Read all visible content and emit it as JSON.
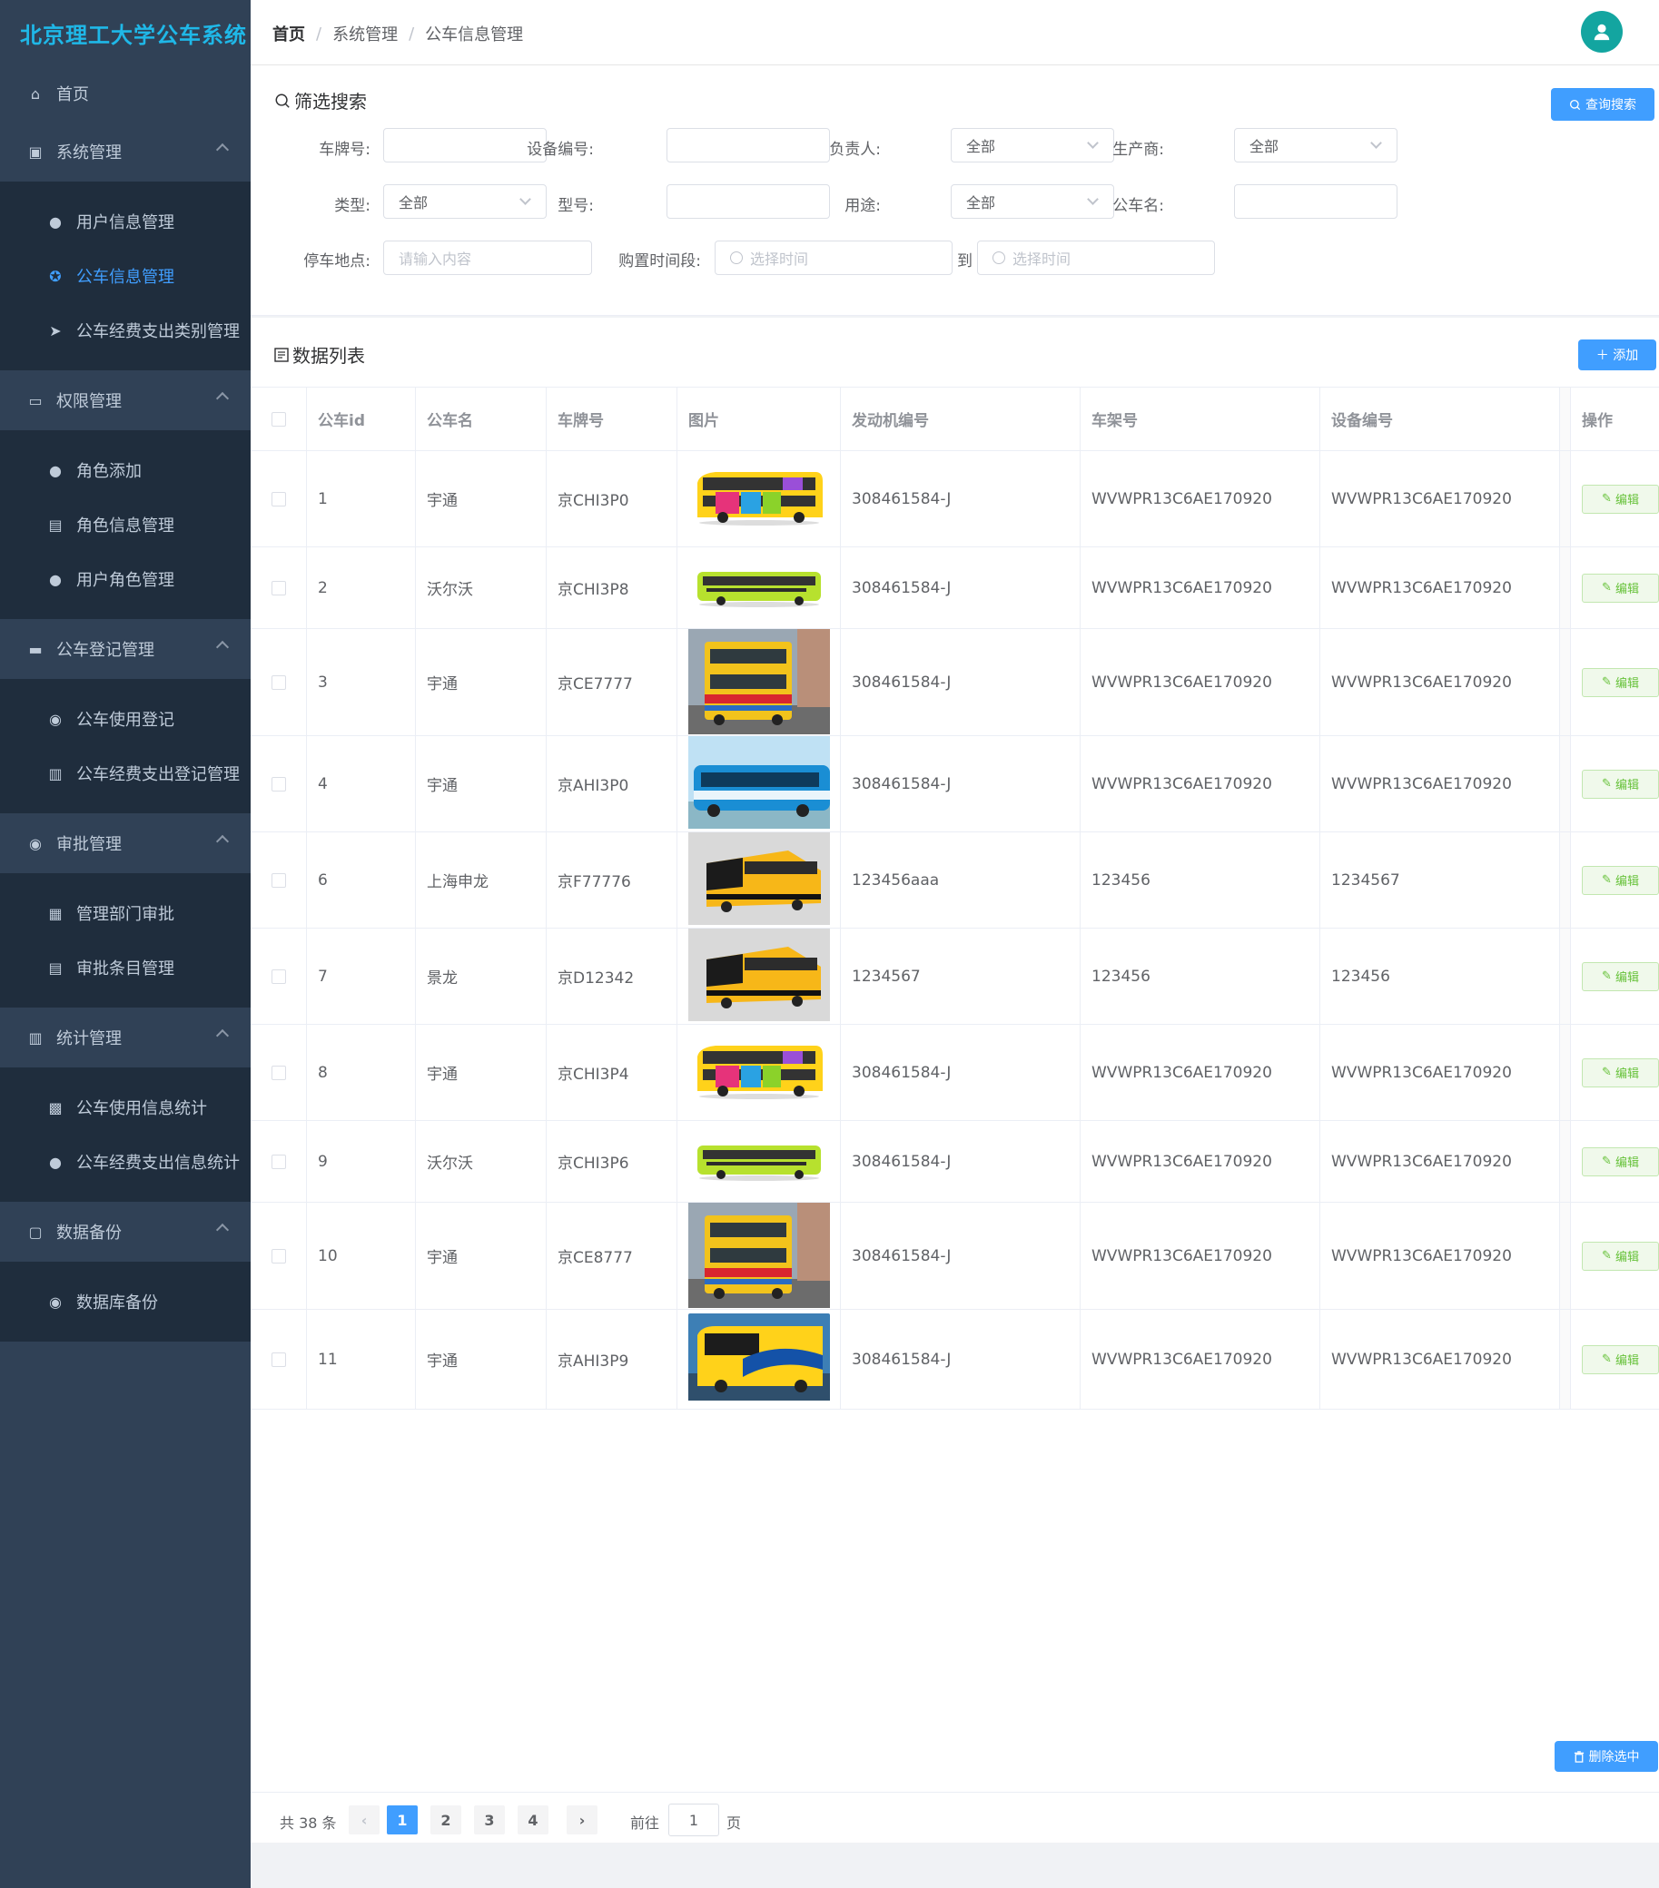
{
  "app": {
    "title": "北京理工大学公车系统"
  },
  "sidebar": {
    "home": "首页",
    "groups": [
      {
        "title": "系统管理",
        "icon": "chip-icon",
        "items": [
          {
            "label": "用户信息管理",
            "icon": "user-icon",
            "active": false
          },
          {
            "label": "公车信息管理",
            "icon": "steering-icon",
            "active": true
          },
          {
            "label": "公车经费支出类别管理",
            "icon": "send-icon",
            "active": false
          }
        ]
      },
      {
        "title": "权限管理",
        "icon": "card-icon",
        "items": [
          {
            "label": "角色添加",
            "icon": "user-icon",
            "active": false
          },
          {
            "label": "角色信息管理",
            "icon": "clipboard-icon",
            "active": false
          },
          {
            "label": "用户角色管理",
            "icon": "user-icon",
            "active": false
          }
        ]
      },
      {
        "title": "公车登记管理",
        "icon": "monitor-icon",
        "items": [
          {
            "label": "公车使用登记",
            "icon": "pin-icon",
            "active": false
          },
          {
            "label": "公车经费支出登记管理",
            "icon": "bar-icon",
            "active": false
          }
        ]
      },
      {
        "title": "审批管理",
        "icon": "pin-icon",
        "items": [
          {
            "label": "管理部门审批",
            "icon": "grid-icon",
            "active": false
          },
          {
            "label": "审批条目管理",
            "icon": "clipboard-icon",
            "active": false
          }
        ]
      },
      {
        "title": "统计管理",
        "icon": "bar-icon",
        "items": [
          {
            "label": "公车使用信息统计",
            "icon": "briefcase-icon",
            "active": false
          },
          {
            "label": "公车经费支出信息统计",
            "icon": "user-icon",
            "active": false
          }
        ]
      },
      {
        "title": "数据备份",
        "icon": "lock-icon",
        "items": [
          {
            "label": "数据库备份",
            "icon": "pin-icon",
            "active": false
          }
        ]
      }
    ]
  },
  "breadcrumb": [
    "首页",
    "系统管理",
    "公车信息管理"
  ],
  "filter": {
    "title": "筛选搜索",
    "search_button": "查询搜索",
    "plate_label": "车牌号:",
    "device_label": "设备编号:",
    "owner_label": "负责人:",
    "owner_value": "全部",
    "maker_label": "生产商:",
    "maker_value": "全部",
    "type_label": "类型:",
    "type_value": "全部",
    "model_label": "型号:",
    "use_label": "用途:",
    "use_value": "全部",
    "bus_name_label": "公车名:",
    "parking_label": "停车地点:",
    "parking_placeholder": "请输入内容",
    "purchase_label": "购置时间段:",
    "date_placeholder": "选择时间",
    "to_label": "到"
  },
  "list": {
    "title": "数据列表",
    "add_button": "＋ 添加",
    "delete_button": "删除选中",
    "edit_label": "编辑",
    "columns": [
      "公车id",
      "公车名",
      "车牌号",
      "图片",
      "发动机编号",
      "车架号",
      "设备编号",
      "操作"
    ],
    "rows": [
      {
        "id": "1",
        "name": "宇通",
        "plate": "京CHI3P0",
        "engine": "308461584-J",
        "frame": "WVWPR13C6AE170920",
        "device": "WVWPR13C6AE170920",
        "img": "double-colorful"
      },
      {
        "id": "2",
        "name": "沃尔沃",
        "plate": "京CHI3P8",
        "engine": "308461584-J",
        "frame": "WVWPR13C6AE170920",
        "device": "WVWPR13C6AE170920",
        "img": "single-green"
      },
      {
        "id": "3",
        "name": "宇通",
        "plate": "京CE7777",
        "engine": "308461584-J",
        "frame": "WVWPR13C6AE170920",
        "device": "WVWPR13C6AE170920",
        "img": "double-yellow-photo"
      },
      {
        "id": "4",
        "name": "宇通",
        "plate": "京AHI3P0",
        "engine": "308461584-J",
        "frame": "WVWPR13C6AE170920",
        "device": "WVWPR13C6AE170920",
        "img": "blue-photo"
      },
      {
        "id": "6",
        "name": "上海申龙",
        "plate": "京F77776",
        "engine": "123456aaa",
        "frame": "123456",
        "device": "1234567",
        "img": "coach-yellow"
      },
      {
        "id": "7",
        "name": "景龙",
        "plate": "京D12342",
        "engine": "1234567",
        "frame": "123456",
        "device": "123456",
        "img": "coach-yellow"
      },
      {
        "id": "8",
        "name": "宇通",
        "plate": "京CHI3P4",
        "engine": "308461584-J",
        "frame": "WVWPR13C6AE170920",
        "device": "WVWPR13C6AE170920",
        "img": "double-colorful"
      },
      {
        "id": "9",
        "name": "沃尔沃",
        "plate": "京CHI3P6",
        "engine": "308461584-J",
        "frame": "WVWPR13C6AE170920",
        "device": "WVWPR13C6AE170920",
        "img": "single-green"
      },
      {
        "id": "10",
        "name": "宇通",
        "plate": "京CE8777",
        "engine": "308461584-J",
        "frame": "WVWPR13C6AE170920",
        "device": "WVWPR13C6AE170920",
        "img": "double-yellow-photo"
      },
      {
        "id": "11",
        "name": "宇通",
        "plate": "京AHI3P9",
        "engine": "308461584-J",
        "frame": "WVWPR13C6AE170920",
        "device": "WVWPR13C6AE170920",
        "img": "coach-colorful"
      }
    ]
  },
  "pager": {
    "total": "共 38 条",
    "pages": [
      "1",
      "2",
      "3",
      "4"
    ],
    "current": "1",
    "goto_label": "前往",
    "goto_value": "1",
    "page_suffix": "页"
  },
  "colors": {
    "sidebar": "#304156",
    "submenu": "#1f2d3d",
    "accent": "#409eff",
    "brand": "#1fb8e8",
    "edit": "#67c23a",
    "avatar": "#13a5a0"
  }
}
